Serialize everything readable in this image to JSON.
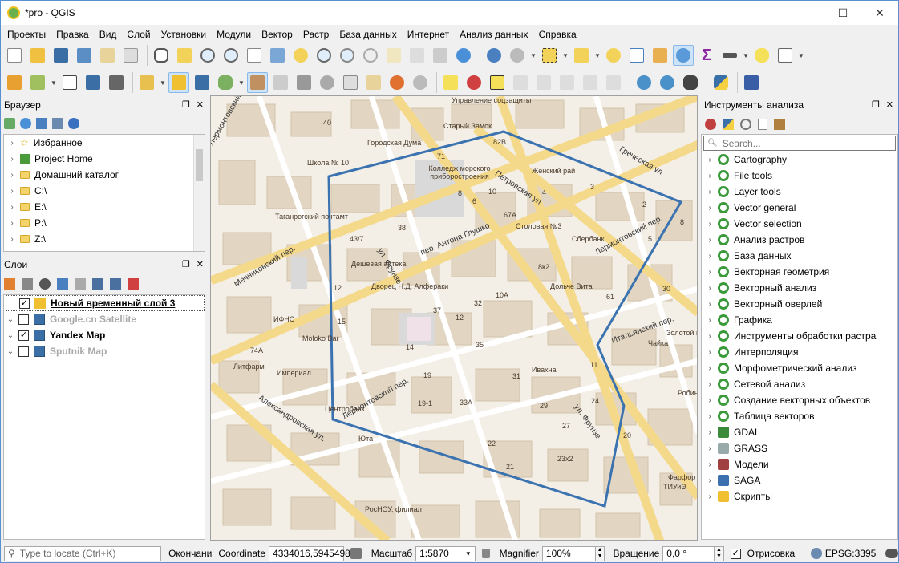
{
  "window": {
    "title": "*pro - QGIS",
    "minimize": "—",
    "maximize": "☐",
    "close": "✕"
  },
  "menu": [
    "Проекты",
    "Правка",
    "Вид",
    "Слой",
    "Установки",
    "Модули",
    "Вектор",
    "Растр",
    "База данных",
    "Интернет",
    "Анализ данных",
    "Справка"
  ],
  "browser": {
    "title": "Браузер",
    "items": [
      {
        "label": "Избранное",
        "icon": "star-icon"
      },
      {
        "label": "Project Home",
        "icon": "qgis-project-icon"
      },
      {
        "label": "Домашний каталог",
        "icon": "folder-icon"
      },
      {
        "label": "C:\\",
        "icon": "folder-icon"
      },
      {
        "label": "E:\\",
        "icon": "folder-icon"
      },
      {
        "label": "P:\\",
        "icon": "folder-icon"
      },
      {
        "label": "Z:\\",
        "icon": "folder-icon"
      }
    ]
  },
  "layers": {
    "title": "Слои",
    "items": [
      {
        "label": "Новый временный слой 3",
        "checked": true,
        "style": "bold-underline",
        "icon": "pencil-layer-icon"
      },
      {
        "label": "Google.cn Satellite",
        "checked": false,
        "style": "bold-grey",
        "icon": "raster-layer-icon"
      },
      {
        "label": "Yandex Map",
        "checked": true,
        "style": "bold",
        "icon": "raster-layer-icon"
      },
      {
        "label": "Sputnik Map",
        "checked": false,
        "style": "bold-grey",
        "icon": "raster-layer-icon"
      }
    ]
  },
  "toolbox": {
    "title": "Инструменты анализа",
    "search_placeholder": "Search...",
    "items": [
      "Cartography",
      "File tools",
      "Layer tools",
      "Vector general",
      "Vector selection",
      "Анализ растров",
      "База данных",
      "Векторная геометрия",
      "Векторный анализ",
      "Векторный оверлей",
      "Графика",
      "Инструменты обработки растра",
      "Интерполяция",
      "Морфометрический анализ",
      "Сетевой анализ",
      "Создание векторных объектов",
      "Таблица векторов",
      "GDAL",
      "GRASS",
      "Модели",
      "SAGA",
      "Скрипты"
    ]
  },
  "map": {
    "streets": [
      "пер. Антона Глушко",
      "Петровская ул.",
      "Греческая ул.",
      "Лермонтовский пер.",
      "Мечниковский пер.",
      "Итальянский пер.",
      "Александровская ул.",
      "ул. Фрунзе",
      "Лермонтовский пер.",
      "ул. Фрунзе",
      "Лермонтовский пер."
    ],
    "pois": [
      "Управление соцзащиты",
      "Старый Замок",
      "Городская Дума",
      "Школа № 10",
      "Колледж морского приборостроения",
      "Женский рай",
      "Таганрогский почтамт",
      "Дешевая аптека",
      "Столовая №3",
      "Сбербанк",
      "Дворец Н.Д. Алферaки",
      "Дольче Вита",
      "ИФНС",
      "Moloko Bar",
      "Золотой колос",
      "Чайка",
      "Литфарм",
      "Империал",
      "Ивахна",
      "Центробанк",
      "Юта",
      "РосНОУ, филиал",
      "Фарфор",
      "ТИУиЭ",
      "Робин"
    ],
    "buildings": [
      "40",
      "82В",
      "71",
      "43/7",
      "38",
      "8",
      "6",
      "10",
      "67А",
      "4",
      "3",
      "2",
      "8к2",
      "10А",
      "32",
      "37",
      "12",
      "14",
      "35",
      "31",
      "19",
      "19-1",
      "33А",
      "22",
      "29",
      "27",
      "21",
      "23х2",
      "24",
      "20",
      "15",
      "12",
      "11",
      "61",
      "30",
      "74А",
      "8",
      "5"
    ]
  },
  "status": {
    "locate_placeholder": "Type to locate (Ctrl+K)",
    "message": "Окончани",
    "coord_label": "Coordinate",
    "coord_value": "4334016,5945498",
    "scale_label": "Масштаб",
    "scale_value": "1:5870",
    "magnifier_label": "Magnifier",
    "magnifier_value": "100%",
    "rotation_label": "Вращение",
    "rotation_value": "0,0 °",
    "render_label": "Отрисовка",
    "render_checked": true,
    "crs": "EPSG:3395"
  },
  "colors": {
    "polygon": "#3b72b0",
    "accent": "#cde3f7",
    "road_major": "#f5d98a",
    "road_minor": "#ffffff",
    "building": "#e0d3bf",
    "background": "#f3efe6"
  }
}
